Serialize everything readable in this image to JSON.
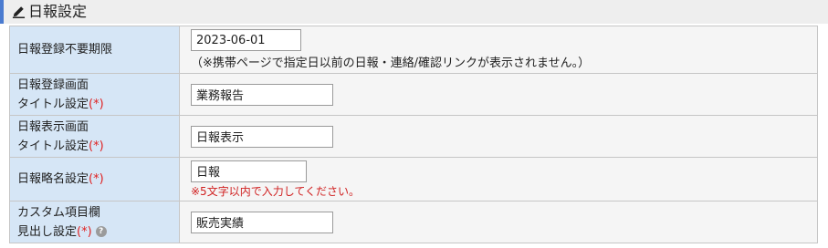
{
  "section": {
    "title": "日報設定",
    "icon": "pencil-icon"
  },
  "rows": [
    {
      "label_line1": "日報登録不要期限",
      "value": "2023-06-01",
      "note": "（※携帯ページで指定日以前の日報・連絡/確認リンクが表示されません。）"
    },
    {
      "label_line1": "日報登録画面",
      "label_line2": "タイトル設定",
      "required": "(*)",
      "value": "業務報告"
    },
    {
      "label_line1": "日報表示画面",
      "label_line2": "タイトル設定",
      "required": "(*)",
      "value": "日報表示"
    },
    {
      "label_line1": "日報略名設定",
      "required": "(*)",
      "value": "日報",
      "error": "※5文字以内で入力してください。"
    },
    {
      "label_line1": "カスタム項目欄",
      "label_line2": "見出し設定",
      "required": "(*)",
      "value": "販売実績",
      "help_icon": "question-circle-icon"
    }
  ],
  "colors": {
    "accent": "#4a7bd0",
    "label_bg": "#d6e6f6",
    "required": "#e02020",
    "error": "#d02020"
  }
}
